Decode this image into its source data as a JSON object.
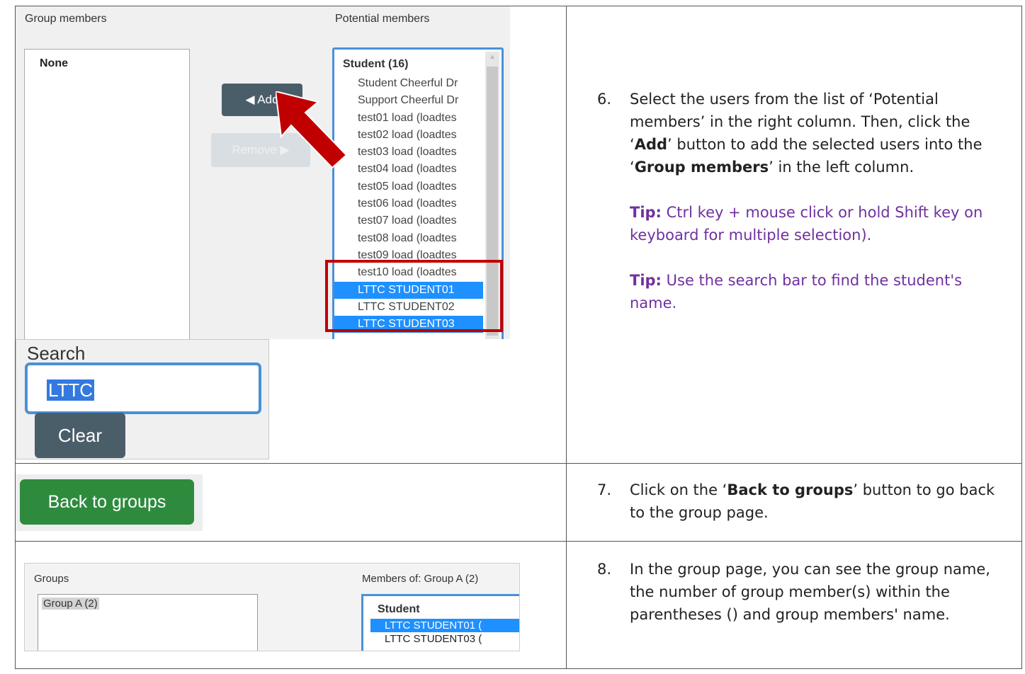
{
  "step6": {
    "number": "6.",
    "text_1": "Select the users from the list of ‘Potential members’ in the right column. Then, click the ‘",
    "bold_1": "Add",
    "text_2": "’ button to add the selected users into the ‘",
    "bold_2": "Group members",
    "text_3": "’ in the left column.",
    "tip1_label": "Tip:",
    "tip1_text": " Ctrl key + mouse click or hold Shift key on keyboard for multiple selection).",
    "tip2_label": "Tip:",
    "tip2_text": " Use the search bar to find the student's name."
  },
  "step7": {
    "number": "7.",
    "text_1": "Click on the ‘",
    "bold_1": "Back to groups",
    "text_2": "’ button to go back to the group page."
  },
  "step8": {
    "number": "8.",
    "text": "In the group page, you can see the group name, the number of group member(s) within the parentheses () and group members' name."
  },
  "members_screen": {
    "group_members_label": "Group members",
    "potential_members_label": "Potential members",
    "group_members_empty": "None",
    "add_button": "◀ Add",
    "remove_button": "Remove ▶",
    "potential_heading": "Student (16)",
    "potential_items": [
      {
        "label": "Student Cheerful Dr",
        "selected": false
      },
      {
        "label": "Support Cheerful Dr",
        "selected": false
      },
      {
        "label": "test01 load (loadtes",
        "selected": false
      },
      {
        "label": "test02 load (loadtes",
        "selected": false
      },
      {
        "label": "test03 load (loadtes",
        "selected": false
      },
      {
        "label": "test04 load (loadtes",
        "selected": false
      },
      {
        "label": "test05 load (loadtes",
        "selected": false
      },
      {
        "label": "test06 load (loadtes",
        "selected": false
      },
      {
        "label": "test07 load (loadtes",
        "selected": false
      },
      {
        "label": "test08 load (loadtes",
        "selected": false
      },
      {
        "label": "test09 load (loadtes",
        "selected": false
      },
      {
        "label": "test10 load (loadtes",
        "selected": false
      },
      {
        "label": "LTTC STUDENT01",
        "selected": true
      },
      {
        "label": "LTTC STUDENT02",
        "selected": false
      },
      {
        "label": "LTTC STUDENT03",
        "selected": true
      }
    ],
    "search_label": "Search",
    "search_value": "LTTC",
    "clear_button": "Clear"
  },
  "back_screen": {
    "back_button": "Back to groups"
  },
  "groups_screen": {
    "groups_label": "Groups",
    "members_label": "Members of: Group A (2)",
    "group_item": "Group A (2)",
    "members_heading": "Student",
    "member_items": [
      {
        "label": "LTTC STUDENT01 (",
        "selected": true
      },
      {
        "label": "LTTC STUDENT03 (",
        "selected": false
      }
    ]
  },
  "colors": {
    "selection_blue": "#1e90ff",
    "highlight_red": "#c00000",
    "tip_purple": "#7030a0",
    "back_green": "#2e8b3e",
    "button_slate": "#4a5e6a"
  }
}
